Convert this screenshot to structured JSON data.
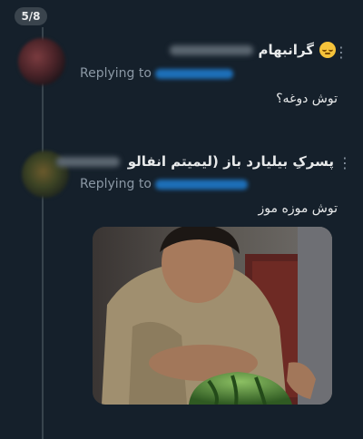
{
  "counter": "5/8",
  "tweets": [
    {
      "display_name": "گرانبهام",
      "emoji": "relieved-face-emoji",
      "replying_to": "Replying to",
      "text": "توش دوغه؟"
    },
    {
      "display_name": "پسرکِ بیلیارد باز (لیمیتم انفالو ن",
      "replying_to": "Replying to",
      "text": "توش موزه موز"
    }
  ],
  "colors": {
    "background": "#15202b",
    "text": "#e7e9ea",
    "muted": "#8b98a5",
    "link": "#1d9bf0"
  }
}
